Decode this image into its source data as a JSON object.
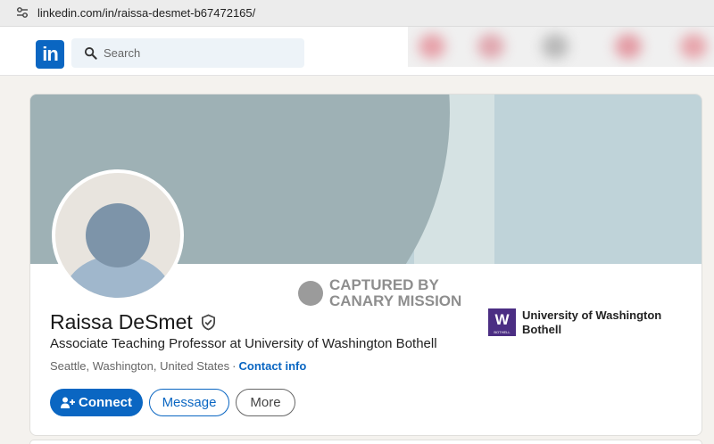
{
  "browser": {
    "url": "linkedin.com/in/raissa-desmet-b67472165/"
  },
  "nav": {
    "logo_text": "in",
    "search_placeholder": "Search"
  },
  "watermark": {
    "line1": "CAPTURED BY",
    "line2": "CANARY MISSION"
  },
  "profile": {
    "name": "Raissa DeSmet",
    "headline": "Associate Teaching Professor at University of Washington Bothell",
    "location": "Seattle, Washington, United States",
    "separator": "·",
    "contact_info": "Contact info",
    "buttons": {
      "connect": "Connect",
      "message": "Message",
      "more": "More"
    },
    "education": {
      "logo_letter": "W",
      "logo_sub": "BOTHELL",
      "name": "University of Washington Bothell"
    }
  },
  "colors": {
    "linkedin_blue": "#0a66c2",
    "uw_purple": "#4b2e83",
    "banner_light": "#bfd3d9",
    "banner_dark": "#9eb1b5"
  }
}
